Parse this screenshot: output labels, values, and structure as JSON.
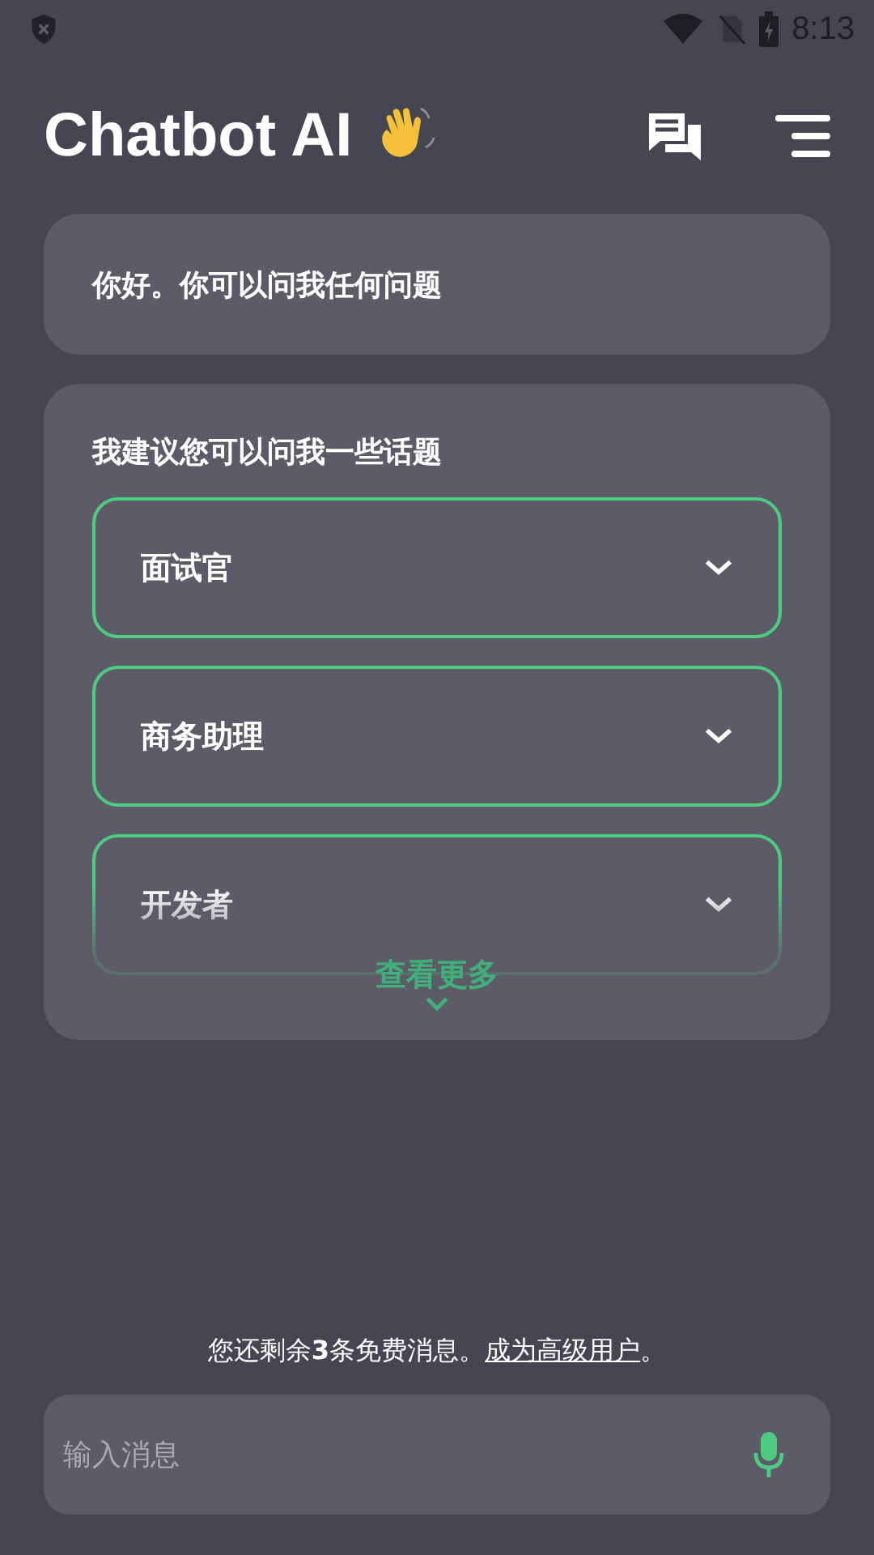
{
  "status_bar": {
    "time": "8:13"
  },
  "header": {
    "title": "Chatbot AI"
  },
  "greeting": {
    "text": "你好。你可以问我任何问题"
  },
  "suggestions": {
    "title": "我建议您可以问我一些话题",
    "topics": [
      {
        "label": "面试官",
        "expanded": false
      },
      {
        "label": "商务助理",
        "expanded": false
      },
      {
        "label": "开发者",
        "expanded": false
      }
    ],
    "more": "查看更多"
  },
  "notice": {
    "text": "您还剩余**3**条免费消息。",
    "link": "成为高级用户",
    "suffix": "。"
  },
  "input": {
    "placeholder": "输入消息"
  }
}
